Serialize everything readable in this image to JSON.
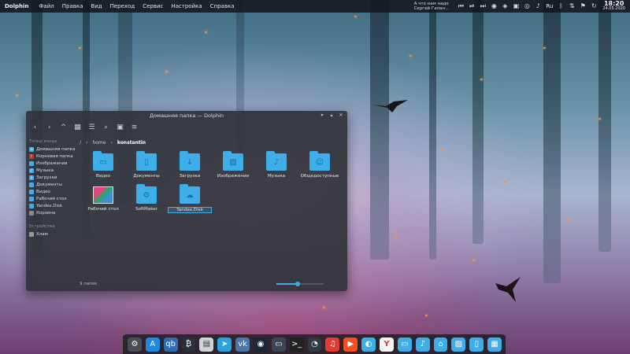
{
  "top_panel": {
    "app_name": "Dolphin",
    "menu": [
      "Файл",
      "Правка",
      "Вид",
      "Переход",
      "Сервис",
      "Настройка",
      "Справка"
    ],
    "notification_line1": "А что нам надо",
    "notification_line2": "Сергей Галан...",
    "language": "Ru",
    "time": "18:20",
    "date": "24.05.2020"
  },
  "window": {
    "title": "Домашняя папка — Dolphin",
    "sidebar": {
      "places_header": "Точки входа",
      "places": [
        "Домашняя папка",
        "Корневая папка",
        "Изображения",
        "Музыка",
        "Загрузки",
        "Документы",
        "Видео",
        "Рабочий стол",
        "Yandex.Disk",
        "Корзина"
      ],
      "devices_header": "Устройства",
      "devices": [
        "Хлам"
      ]
    },
    "breadcrumb": [
      "/",
      "home",
      "konstantin"
    ],
    "items": [
      "Видео",
      "Документы",
      "Загрузки",
      "Изображения",
      "Музыка",
      "Общедоступные",
      "Рабочий стол",
      "SoftMaker",
      "Yandex.Disk"
    ],
    "status": "9 папок",
    "zoom_level": 0.45
  },
  "dock_icons": [
    "settings-icon",
    "app-store-icon",
    "qbittorrent-icon",
    "bitcoin-icon",
    "printer-icon",
    "telegram-icon",
    "vk-icon",
    "steam-icon",
    "monitor-icon",
    "terminal-icon",
    "system-monitor-icon",
    "music-player-icon",
    "media-player-icon",
    "dolphin-icon",
    "yandex-browser-icon",
    "folder-icon",
    "music-folder-icon",
    "home-folder-icon",
    "pictures-folder-icon",
    "document-folder-icon",
    "files-folder-icon"
  ],
  "colors": {
    "accent": "#3daee9",
    "panel_bg": "#14161a",
    "window_bg": "#303238"
  }
}
